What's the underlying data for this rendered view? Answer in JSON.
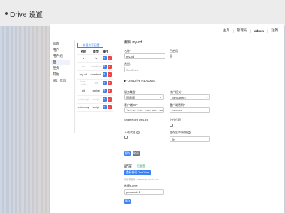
{
  "doc": {
    "title": "Drive 设置"
  },
  "topnav": {
    "items": [
      "主页",
      "管理员",
      "admin",
      "注销"
    ]
  },
  "sidenav": {
    "items": [
      "状态",
      "用户",
      "用户组",
      "盘",
      "任务",
      "其他",
      "统计信息"
    ],
    "active": 3
  },
  "list": {
    "new_share_button": "+ 新建共享配置",
    "headers": [
      "名称",
      "类型",
      "操作"
    ],
    "rows": [
      {
        "name": "a",
        "type": "fs",
        "faded": false
      },
      {
        "name": "nn",
        "type": "onedrive",
        "faded": true
      },
      {
        "name": "my-od",
        "type": "onedrive",
        "faded": false
      },
      {
        "name": "local-vedio",
        "type": "git",
        "faded": true
      },
      {
        "name": "git",
        "type": "gdrive",
        "faded": false
      },
      {
        "name": "test-script",
        "type": "script",
        "faded": true
      },
      {
        "name": "test-proxy",
        "type": "script",
        "faded": false
      }
    ]
  },
  "form": {
    "header": "编辑 my-od",
    "name_label": "名称*",
    "name_value": "my-od",
    "enabled_label": "已启用",
    "enabled_value": "是",
    "type_label": "类型*",
    "type_value": "OneDrive",
    "readme_toggle": "▶ OneDrive README",
    "service_type_label": "服务类型*",
    "service_type_value": "国际版",
    "tenant_label": "帐户模式*",
    "tenant_value": "consumers",
    "client_id_label": "客户端 ID*",
    "client_id_value": "7■4c■■-6b■4-4d■■-■■fd-d■■■b■■■",
    "client_secret_label": "客户端密码*",
    "client_secret_value": "••••••••••",
    "sharepoint_label": "SharePoint URL",
    "upload_proxy_label": "上传代理",
    "download_proxy_label": "下载代理",
    "cache_ttl_label": "缓存生命周期",
    "cache_ttl_value": "2h",
    "save_button": "保存",
    "cancel_button": "取消",
    "config_header": "配置",
    "config_status": "已配置",
    "authorize_button": "重新授权 OneDrive",
    "account_hint": "已授权账号: m■■■■@outlook.com",
    "drive_label": "选择 Drive*",
    "drive_value": "personal: 1",
    "apply_button": "保存"
  },
  "colors": {
    "accent": "#3b82f6",
    "danger": "#ef4444"
  }
}
